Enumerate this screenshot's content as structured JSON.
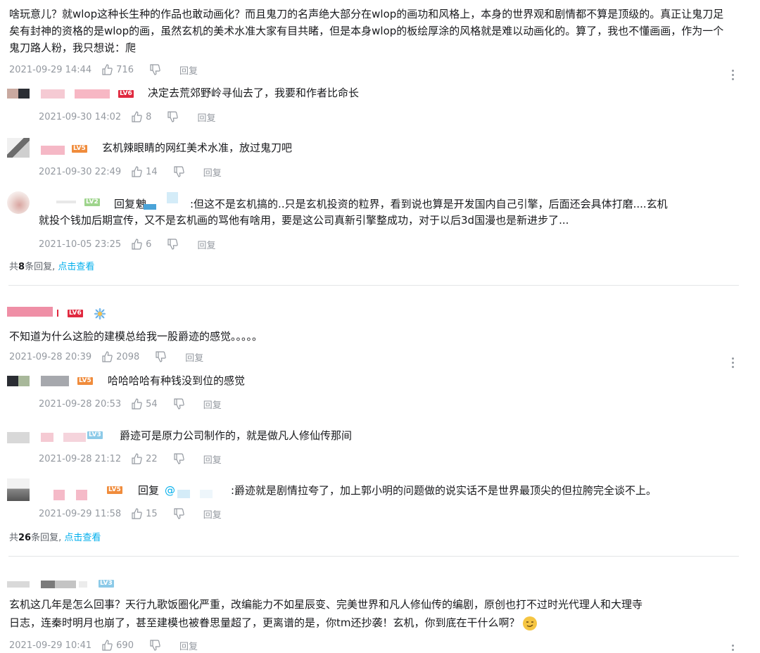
{
  "comments": [
    {
      "text": "啥玩意儿？就wlop这种长生种的作品也敢动画化？而且鬼刀的名声绝大部分在wlop的画功和风格上，本身的世界观和剧情都不算是顶级的。真正让鬼刀足矣有封神的资格的是wlop的画，虽然玄机的美术水准大家有目共睹，但是本身wlop的板绘厚涂的风格就是难以动画化的。算了，我也不懂画画，作为一个鬼刀路人粉，我只想说：爬",
      "time": "2021-09-29 14:44",
      "likes": "716",
      "reply_label": "回复",
      "replies": [
        {
          "level": "LV6",
          "text": "决定去荒郊野岭寻仙去了，我要和作者比命长",
          "time": "2021-09-30 14:02",
          "likes": "8",
          "reply_label": "回复"
        },
        {
          "level": "LV5",
          "text": "玄机辣眼睛的网红美术水准，放过鬼刀吧",
          "time": "2021-09-30 22:49",
          "likes": "14",
          "reply_label": "回复"
        },
        {
          "level": "LV2",
          "prefix": "回复",
          "line1": ":但这不是玄机搞的..只是玄机投资的粒界，看到说也算是开发国内自己引擎，后面还会具体打磨....玄机",
          "line2": "就投个钱加后期宣传，又不是玄机画的骂他有啥用，要是这公司真新引擎整成功，对于以后3d国漫也是新进步了...",
          "time": "2021-10-05 23:25",
          "likes": "6",
          "reply_label": "回复"
        }
      ],
      "summary": {
        "pre": "共",
        "count": "8",
        "post": "条回复,",
        "link": "点击查看"
      }
    },
    {
      "level": "LV6",
      "text": "不知道为什么这脸的建模总给我一股爵迹的感觉。。。。。",
      "time": "2021-09-28 20:39",
      "likes": "2098",
      "reply_label": "回复",
      "replies": [
        {
          "level": "LV5",
          "text": "哈哈哈哈有种钱没到位的感觉",
          "time": "2021-09-28 20:53",
          "likes": "54",
          "reply_label": "回复"
        },
        {
          "level": "LV3",
          "text": "爵迹可是原力公司制作的，就是做凡人修仙传那间",
          "time": "2021-09-28 21:12",
          "likes": "22",
          "reply_label": "回复"
        },
        {
          "level": "LV5",
          "prefix": "回复",
          "at": "@",
          "text": ":爵迹就是剧情拉夸了，加上郭小明的问题做的说实话不是世界最顶尖的但拉胯完全谈不上。",
          "time": "2021-09-29 11:58",
          "likes": "15",
          "reply_label": "回复"
        }
      ],
      "summary": {
        "pre": "共",
        "count": "26",
        "post": "条回复,",
        "link": "点击查看"
      }
    },
    {
      "level": "LV3",
      "line1": "玄机这几年是怎么回事？天行九歌饭圈化严重，改编能力不如星辰变、完美世界和凡人修仙传的编剧，原创也打不过时光代理人和大理寺",
      "line2": "日志，连秦时明月也崩了，甚至建模也被眷思量超了，更离谱的是，你tm还抄袭！玄机，你到底在干什么啊？",
      "time": "2021-09-29 10:41",
      "likes": "690",
      "reply_label": "回复"
    }
  ],
  "colors": {
    "link": "#00aeec",
    "meta": "#9499a0",
    "lv6": "#e0293f",
    "lv5": "#f08c3c",
    "lv2": "#9ed48c",
    "lv3": "#8ccae8"
  }
}
